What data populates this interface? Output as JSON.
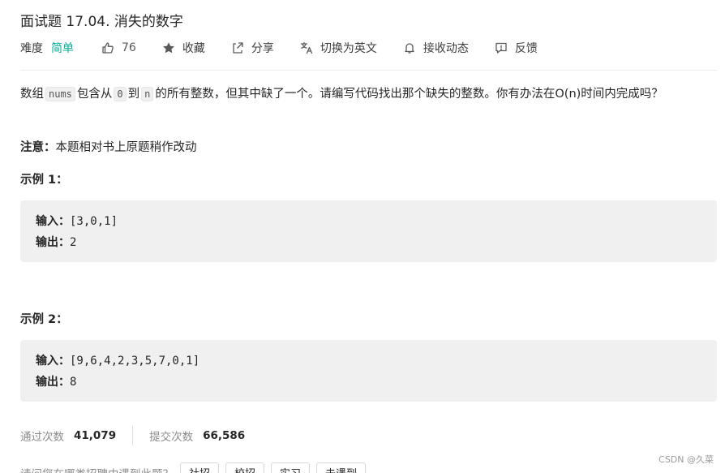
{
  "problem": {
    "title": "面试题 17.04. 消失的数字"
  },
  "meta": {
    "difficulty_label": "难度",
    "difficulty": "简单",
    "likes": "76",
    "favorite": "收藏",
    "share": "分享",
    "translate": "切换为英文",
    "subscribe": "接收动态",
    "feedback": "反馈"
  },
  "description": {
    "part1": "数组",
    "code1": "nums",
    "part2": "包含从",
    "code2": "0",
    "part3": "到",
    "code3": "n",
    "part4": "的所有整数，但其中缺了一个。请编写代码找出那个缺失的整数。你有办法在O(n)时间内完成吗？"
  },
  "note": {
    "label": "注意：",
    "text": "本题相对书上原题稍作改动"
  },
  "examples": [
    {
      "title": "示例 1：",
      "input_label": "输入：",
      "input": "[3,0,1]",
      "output_label": "输出：",
      "output": "2"
    },
    {
      "title": "示例 2：",
      "input_label": "输入：",
      "input": "[9,6,4,2,3,5,7,0,1]",
      "output_label": "输出：",
      "output": "8"
    }
  ],
  "stats": {
    "accepted_label": "通过次数",
    "accepted": "41,079",
    "submissions_label": "提交次数",
    "submissions": "66,586"
  },
  "interview": {
    "question": "请问您在哪类招聘中遇到此题？",
    "tags": [
      "社招",
      "校招",
      "实习",
      "未遇到"
    ]
  },
  "watermark": "CSDN @久菜",
  "colors": {
    "difficulty_easy": "#00af9b",
    "code_bg": "#f0f0f0",
    "text": "#262626",
    "muted": "#8c8c8c"
  }
}
